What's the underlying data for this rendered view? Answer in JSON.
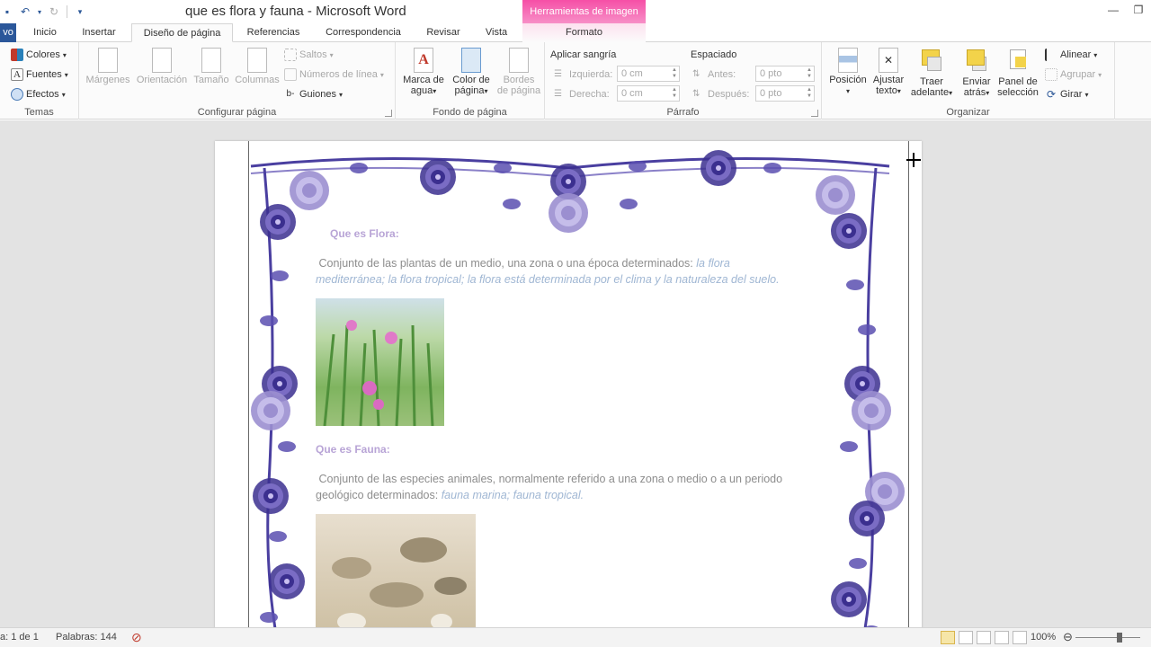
{
  "window": {
    "title": "que es flora y fauna - Microsoft Word",
    "context_tab_header": "Herramientas de imagen"
  },
  "tabs": [
    {
      "label": "vo"
    },
    {
      "label": "Inicio"
    },
    {
      "label": "Insertar"
    },
    {
      "label": "Diseño de página"
    },
    {
      "label": "Referencias"
    },
    {
      "label": "Correspondencia"
    },
    {
      "label": "Revisar"
    },
    {
      "label": "Vista"
    },
    {
      "label": "Formato"
    }
  ],
  "ribbon": {
    "temas": {
      "label": "Temas",
      "colores": "Colores",
      "fuentes": "Fuentes",
      "efectos": "Efectos"
    },
    "configurar": {
      "label": "Configurar página",
      "margenes": "Márgenes",
      "orientacion": "Orientación",
      "tamano": "Tamaño",
      "columnas": "Columnas",
      "saltos": "Saltos",
      "numeros": "Números de línea",
      "guiones": "Guiones"
    },
    "fondo": {
      "label": "Fondo de página",
      "marca_1": "Marca de",
      "marca_2": "agua",
      "color_1": "Color de",
      "color_2": "página",
      "bordes_1": "Bordes",
      "bordes_2": "de página"
    },
    "parrafo": {
      "label": "Párrafo",
      "sangria": "Aplicar sangría",
      "izquierda": "Izquierda:",
      "derecha": "Derecha:",
      "izq_val": "0 cm",
      "der_val": "0 cm",
      "espaciado": "Espaciado",
      "antes": "Antes:",
      "despues": "Después:",
      "antes_val": "0 pto",
      "despues_val": "0 pto"
    },
    "organizar": {
      "label": "Organizar",
      "posicion": "Posición",
      "ajustar_1": "Ajustar",
      "ajustar_2": "texto",
      "traer_1": "Traer",
      "traer_2": "adelante",
      "enviar_1": "Enviar",
      "enviar_2": "atrás",
      "panel_1": "Panel de",
      "panel_2": "selección",
      "alinear": "Alinear",
      "agrupar": "Agrupar",
      "girar": "Girar"
    }
  },
  "document": {
    "flora_heading": "Que es Flora:",
    "flora_text": "Conjunto de las plantas de un medio, una zona o una época determinados:",
    "flora_ex1": "la flora",
    "flora_ex2": "mediterránea; la flora tropical; la flora está determinada por el clima y la naturaleza del suelo.",
    "fauna_heading": "Que es Fauna:",
    "fauna_text1": "Conjunto de las especies animales, normalmente referido a una zona o medio o a un periodo",
    "fauna_text2": "geológico determinados:",
    "fauna_ex": "fauna marina; fauna tropical."
  },
  "status": {
    "page": "a: 1 de 1",
    "words": "Palabras: 144",
    "zoom": "100%"
  },
  "colors": {
    "file_tab": "#2b579a",
    "context_tab": "#f64fa6",
    "rose_dark": "#3b2f8f",
    "rose_light": "#9b8fd0"
  }
}
